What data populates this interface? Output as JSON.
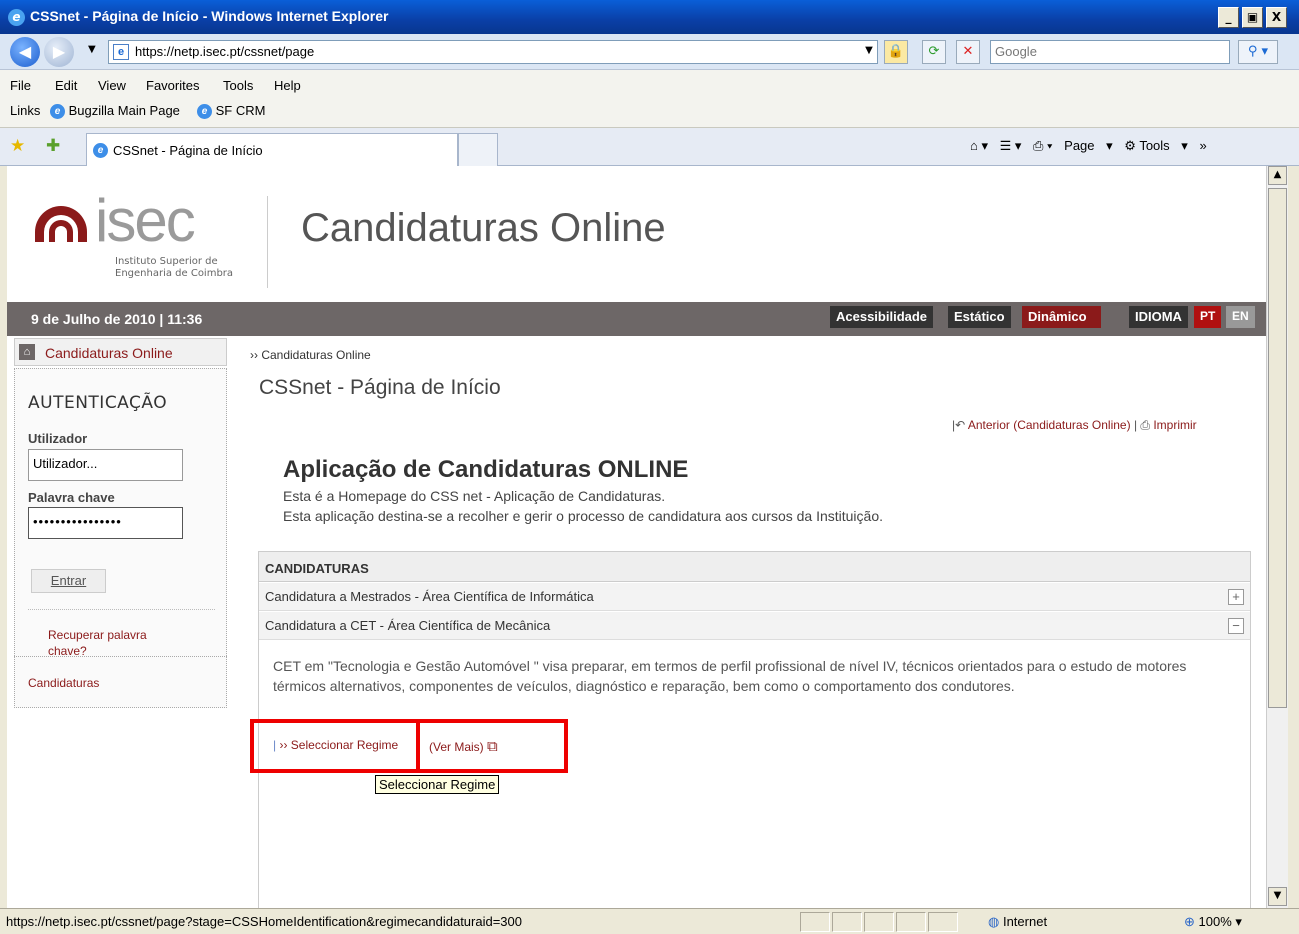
{
  "window": {
    "title": "CSSnet - Página de Início - Windows Internet Explorer",
    "buttons": [
      "_",
      "▣",
      "X"
    ]
  },
  "addressbar": {
    "url": "https://netp.isec.pt/cssnet/page",
    "search_placeholder": "Google"
  },
  "menu": {
    "items": [
      "File",
      "Edit",
      "View",
      "Favorites",
      "Tools",
      "Help"
    ]
  },
  "links": {
    "label": "Links",
    "items": [
      "Bugzilla Main Page",
      "SF CRM"
    ]
  },
  "tab": {
    "title": "CSSnet - Página de Início"
  },
  "tabtools": {
    "page": "Page",
    "tools": "Tools"
  },
  "header": {
    "logo_word": "isec",
    "logo_sub1": "Instituto Superior de",
    "logo_sub2": "Engenharia de Coimbra",
    "site_title": "Candidaturas Online",
    "date": "9 de Julho de 2010 | 11:36",
    "btn_access": "Acessibilidade",
    "btn_static": "Estático",
    "btn_dynamic": "Dinâmico",
    "lang_label": "IDIOMA",
    "lang_pt": "PT",
    "lang_en": "EN"
  },
  "sidebar": {
    "home": "Candidaturas Online",
    "auth_title": "AUTENTICAÇÃO",
    "user_label": "Utilizador",
    "user_value": "Utilizador...",
    "pass_label": "Palavra chave",
    "pass_value": "••••••••••••••••",
    "login_btn": "Entrar",
    "recover": "Recuperar palavra chave?",
    "cand_link": "Candidaturas"
  },
  "main": {
    "breadcrumb": "›› Candidaturas Online",
    "page_title": "CSSnet - Página de Início",
    "back_link": "Anterior (Candidaturas Online)",
    "print_link": "Imprimir",
    "heading": "Aplicação de Candidaturas ONLINE",
    "intro1": "Esta é a Homepage do CSS net - Aplicação de Candidaturas.",
    "intro2": "Esta aplicação destina-se a recolher e gerir o processo de candidatura aos cursos da Instituição.",
    "panel_title": "CANDIDATURAS",
    "row1": "Candidatura a Mestrados - Área Científica de Informática",
    "row2": "Candidatura a CET - Área Científica de Mecânica",
    "description": "CET em \"Tecnologia e Gestão Automóvel \" visa preparar, em termos de perfil profissional de nível IV, técnicos orientados para o estudo de motores térmicos alternativos, componentes de veículos, diagnóstico e reparação, bem como o comportamento dos condutores.",
    "select_link": "›› Seleccionar Regime",
    "more_link": "(Ver Mais)",
    "tooltip": "Seleccionar Regime"
  },
  "status": {
    "url": "https://netp.isec.pt/cssnet/page?stage=CSSHomeIdentification&regimecandidaturaid=300",
    "zone": "Internet",
    "zoom": "100%"
  },
  "colors": {
    "brand": "#8b1a1a",
    "bar": "#6d6767",
    "highlight": "#e00000"
  }
}
